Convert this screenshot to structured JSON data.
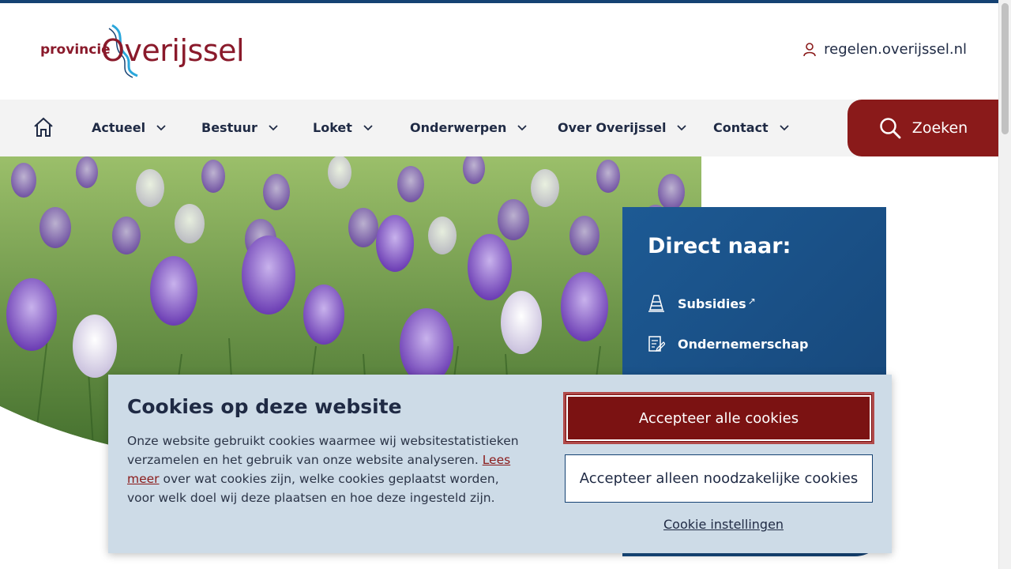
{
  "header": {
    "logo_prefix": "provincie",
    "logo_name": "Overijssel",
    "external_link": "regelen.overijssel.nl"
  },
  "nav": {
    "items": [
      {
        "label": "Actueel"
      },
      {
        "label": "Bestuur"
      },
      {
        "label": "Loket"
      },
      {
        "label": "Onderwerpen"
      },
      {
        "label": "Over Overijssel"
      },
      {
        "label": "Contact"
      }
    ],
    "search_label": "Zoeken"
  },
  "direct": {
    "title": "Direct naar:",
    "links": [
      {
        "label": "Subsidies",
        "external_marker": "↗"
      },
      {
        "label": "Ondernemerschap"
      }
    ]
  },
  "cookie": {
    "title": "Cookies op deze website",
    "text_before": "Onze website gebruikt cookies waarmee wij websitestatistieken verzamelen en het gebruik van onze website analyseren.",
    "link_text": "Lees meer",
    "text_after": "over wat cookies zijn, welke cookies geplaatst worden, voor welk doel wij deze plaatsen en hoe deze ingesteld zijn.",
    "accept_all": "Accepteer alle cookies",
    "accept_necessary": "Accepteer alleen noodzakelijke cookies",
    "settings": "Cookie instellingen"
  },
  "colors": {
    "brand_red": "#8a1a1a",
    "brand_blue": "#154273",
    "cookie_bg": "#cddbe7"
  }
}
